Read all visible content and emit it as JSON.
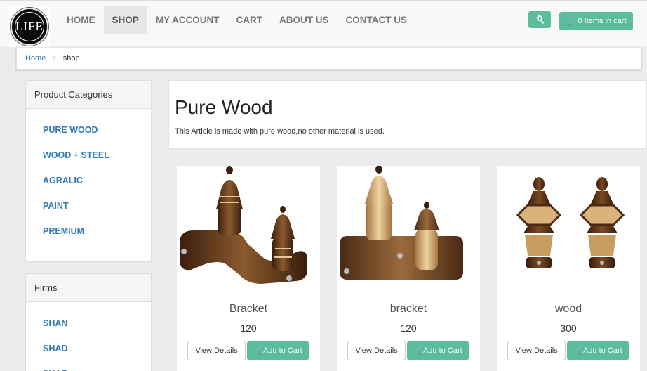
{
  "brand": {
    "logo_text": "LIFE"
  },
  "nav": {
    "items": [
      {
        "label": "HOME"
      },
      {
        "label": "SHOP"
      },
      {
        "label": "MY ACCOUNT"
      },
      {
        "label": "CART"
      },
      {
        "label": "ABOUT US"
      },
      {
        "label": "CONTACT US"
      }
    ],
    "active": "SHOP",
    "cart_label": "0 Items in cart",
    "cart_icon": "shopping-cart-icon",
    "search_icon": "search-icon"
  },
  "breadcrumb": {
    "home": "Home",
    "separator": ">",
    "current": "shop"
  },
  "categories": {
    "title": "Product Categories",
    "items": [
      "PURE WOOD",
      "WOOD + STEEL",
      "AGRALIC",
      "PAINT",
      "PREMIUM"
    ]
  },
  "firms": {
    "title": "Firms",
    "items": [
      "SHAN",
      "SHAD",
      "SHAZ"
    ]
  },
  "category": {
    "title": "Pure Wood",
    "description": "This Article is made with pure wood,no other material is used."
  },
  "products": [
    {
      "name": "Bracket",
      "price": "120",
      "view_label": "View Details",
      "add_label": "Add to Cart"
    },
    {
      "name": "bracket",
      "price": "120",
      "view_label": "View Details",
      "add_label": "Add to Cart"
    },
    {
      "name": "wood",
      "price": "300",
      "view_label": "View Details",
      "add_label": "Add to Cart"
    }
  ],
  "colors": {
    "accent": "#5bbc9e",
    "link": "#337ab7",
    "wood_dark": "#4a2a14",
    "wood_light": "#d9b27c"
  }
}
